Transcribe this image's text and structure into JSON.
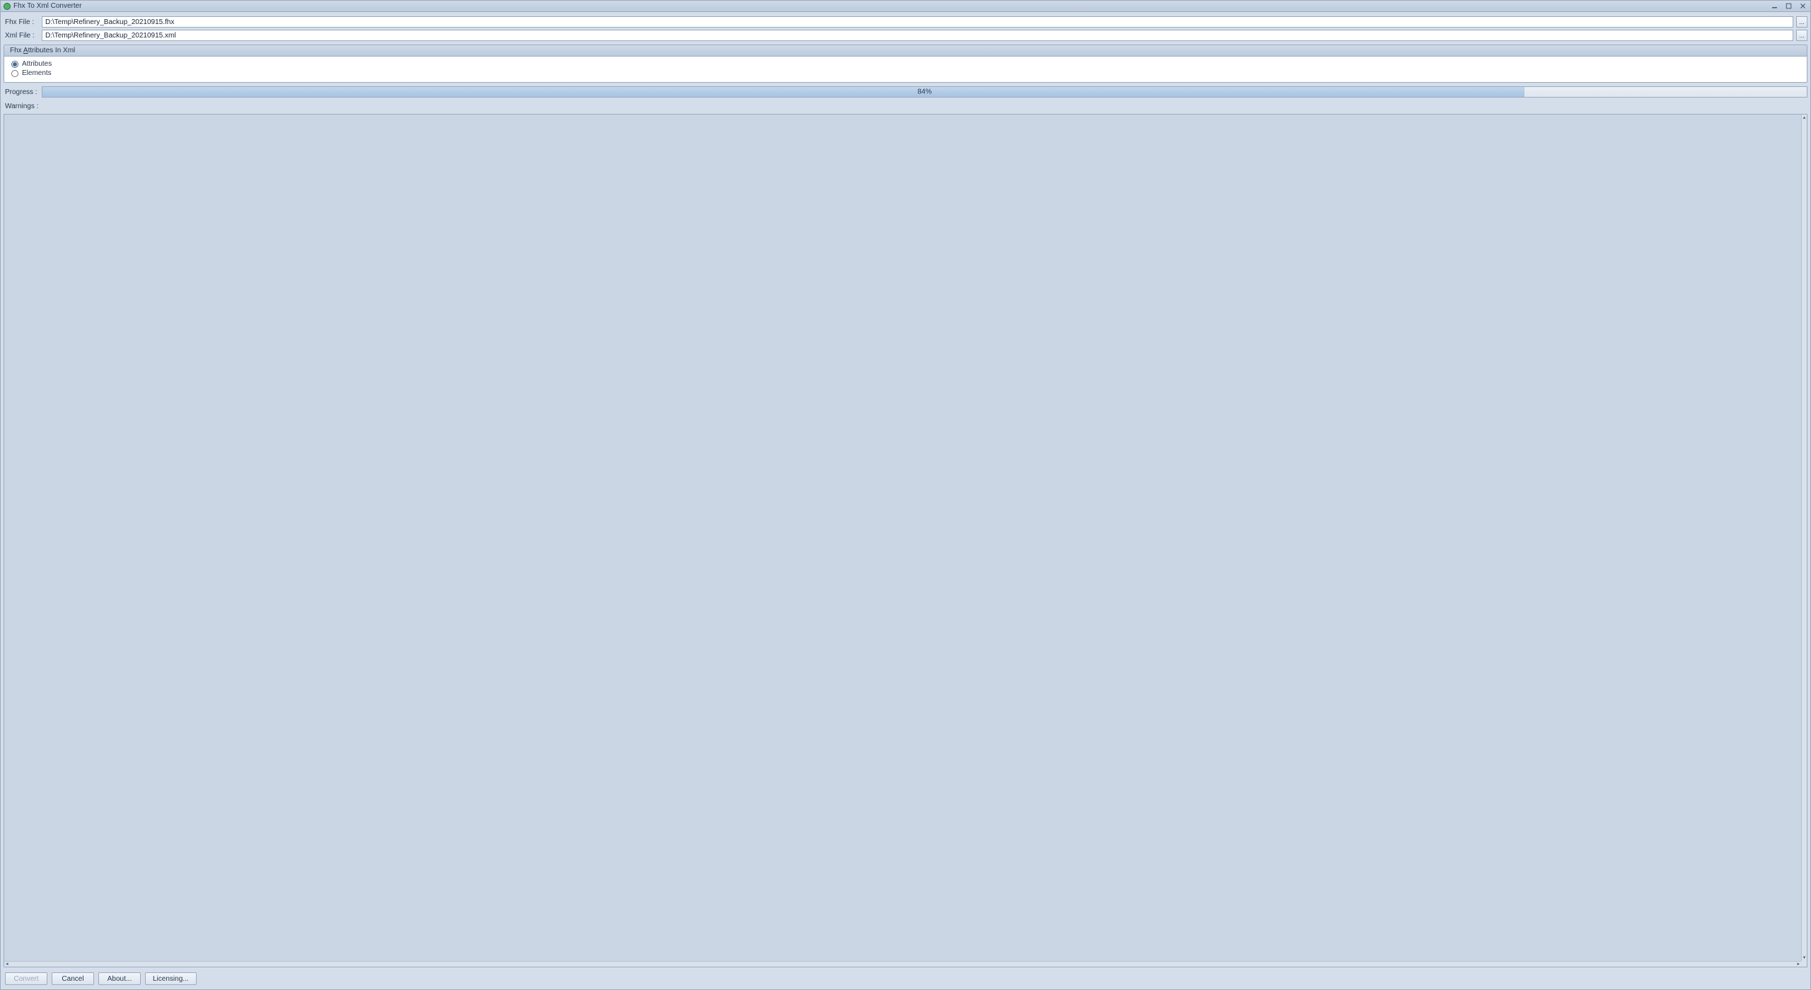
{
  "window": {
    "title": "Fhx To Xml Converter"
  },
  "files": {
    "fhx_label": "Fhx File :",
    "xml_label": "Xml File :",
    "fhx_value": "D:\\Temp\\Refinery_Backup_20210915.fhx",
    "xml_value": "D:\\Temp\\Refinery_Backup_20210915.xml",
    "browse_label": "..."
  },
  "group": {
    "title_prefix": "Fhx ",
    "title_accel": "A",
    "title_suffix": "ttributes In Xml",
    "attributes_label": "Attributes",
    "elements_label": "Elements",
    "selected": "attributes"
  },
  "progress": {
    "label": "Progress :",
    "percent": 84,
    "text": "84%"
  },
  "warnings": {
    "label": "Warnings :",
    "content": ""
  },
  "buttons": {
    "convert": "Convert",
    "cancel": "Cancel",
    "about": "About...",
    "licensing": "Licensing..."
  }
}
